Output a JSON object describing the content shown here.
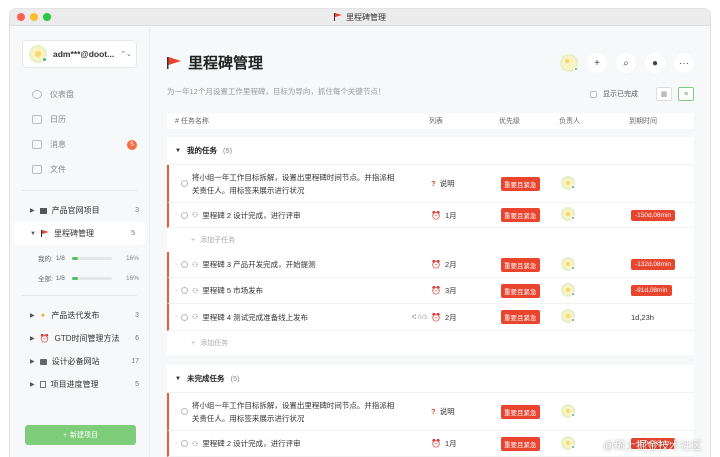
{
  "window": {
    "title": "里程碑管理"
  },
  "sidebar": {
    "user": "adm***@doot...",
    "nav": [
      {
        "label": "仪表盘",
        "icon": "dashboard-icon"
      },
      {
        "label": "日历",
        "icon": "calendar-icon"
      },
      {
        "label": "消息",
        "icon": "message-icon",
        "badge": "5"
      },
      {
        "label": "文件",
        "icon": "file-icon"
      }
    ],
    "projects_top": [
      {
        "label": "产品官网项目",
        "count": "3"
      },
      {
        "label": "里程碑管理",
        "count": "5"
      }
    ],
    "progress": [
      {
        "label": "我的:",
        "ratio": "1/8",
        "pct": "16%",
        "fill": 16
      },
      {
        "label": "全部:",
        "ratio": "1/8",
        "pct": "16%",
        "fill": 16
      }
    ],
    "projects_bottom": [
      {
        "label": "产品迭代发布",
        "count": "3"
      },
      {
        "label": "GTD时间管理方法",
        "count": "6"
      },
      {
        "label": "设计必备网站",
        "count": "17"
      },
      {
        "label": "项目进度管理",
        "count": "5"
      }
    ],
    "new_project": "新建项目"
  },
  "main": {
    "title": "里程碑管理",
    "subtitle": "为一年12个月设置工作里程碑，目标为导向，抓住每个关键节点！",
    "show_completed": "显示已完成",
    "columns": [
      "# 任务名称",
      "列表",
      "优先级",
      "负责人",
      "到期时间"
    ],
    "sections": [
      {
        "title": "我的任务",
        "count": "(5)",
        "rows": [
          {
            "name_line1": "将小组一年工作目标拆解，设置出里程碑时间节点。并指派相",
            "name_line2": "关责任人。用标签来展示进行状况",
            "list": "说明",
            "list_icon": "?",
            "priority": "重要且紧急",
            "due": ""
          },
          {
            "name_line1": "里程碑 2 设计完成，进行评审",
            "list": "1月",
            "list_icon": "⏰",
            "priority": "重要且紧急",
            "due": "-150d,08min"
          }
        ],
        "add": "添加子任务",
        "rows2": [
          {
            "name_line1": "里程碑 3 产品开发完成，开始提测",
            "list": "2月",
            "priority": "重要且紧急",
            "due": "-132d,08min"
          },
          {
            "name_line1": "里程碑 5 市场发布",
            "list": "3月",
            "priority": "重要且紧急",
            "due": "-91d,08min"
          },
          {
            "name_line1": "里程碑 4 测试完成准备线上发布",
            "sub": "0/3",
            "list": "2月",
            "priority": "重要且紧急",
            "due_plain": "1d,23h"
          }
        ],
        "add2": "添加任务"
      },
      {
        "title": "未完成任务",
        "count": "(5)",
        "rows": [
          {
            "name_line1": "将小组一年工作目标拆解，设置出里程碑时间节点。并指派相",
            "name_line2": "关责任人。用标签来展示进行状况",
            "list": "说明",
            "priority": "重要且紧急"
          },
          {
            "name_line1": "里程碑 2 设计完成，进行评审",
            "list": "1月",
            "priority": "重要且紧急",
            "due": "-150d,08min"
          }
        ]
      }
    ]
  },
  "watermark": "@稀土掘金技术社区"
}
